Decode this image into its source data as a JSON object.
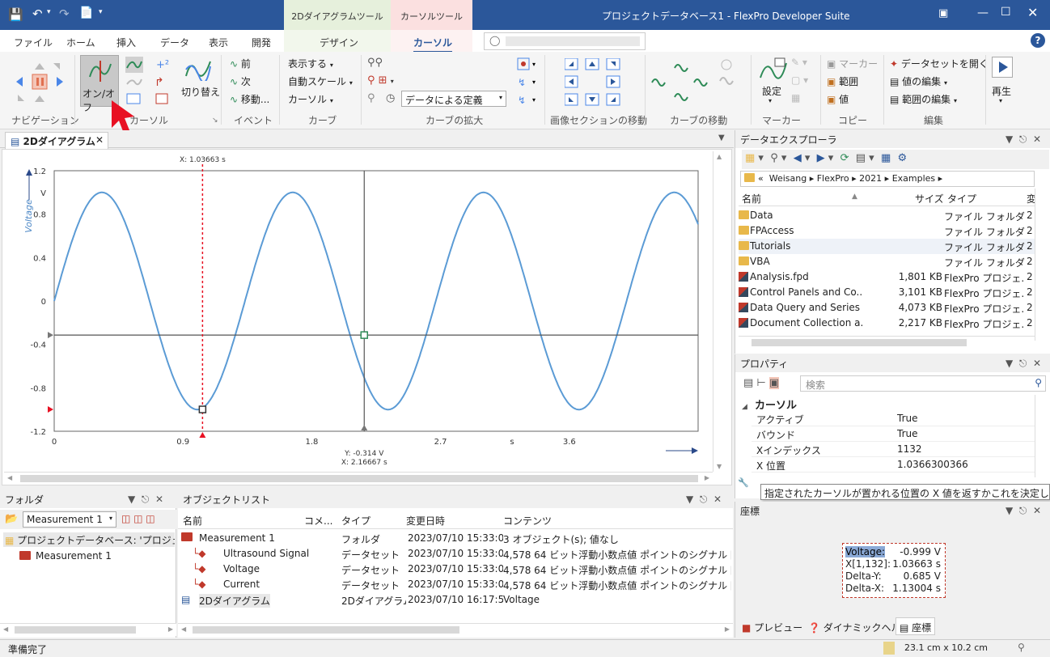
{
  "titlebar": {
    "title": "プロジェクトデータベース1 - FlexPro Developer Suite",
    "context_tab_1": "2Dダイアグラムツール",
    "context_tab_2": "カーソルツール"
  },
  "tabs": [
    "ファイル",
    "ホーム",
    "挿入",
    "データ",
    "表示",
    "開発",
    "デザイン",
    "カーソル"
  ],
  "active_tab": "カーソル",
  "ribbon": {
    "groups": [
      "ナビゲーション",
      "カーソル",
      "イベント",
      "カーブ",
      "カーブの拡大",
      "画像セクションの移動",
      "カーブの移動",
      "マーカー",
      "コピー",
      "編集"
    ],
    "onoff_label": "オン/オフ",
    "switch_label": "切り替え",
    "event_prev": "前",
    "event_next": "次",
    "event_move": "移動...",
    "curve_show": "表示する",
    "curve_autoscale": "自動スケール",
    "curve_cursor": "カーソル",
    "zoom_mode": "データによる定義",
    "settings_label": "設定",
    "marker_label": "マーカー",
    "copy_range": "範囲",
    "copy_value": "値",
    "edit_open_dataset": "データセットを開く",
    "edit_value": "値の編集",
    "edit_range": "範囲の編集",
    "play_label": "再生"
  },
  "doc_tab": {
    "label": "2Dダイアグラム"
  },
  "chart_data": {
    "type": "line",
    "title": "",
    "xlabel": "s",
    "ylabel": "Voltage",
    "yunit": "V",
    "x_ticks": [
      "0",
      "0.9",
      "1.8",
      "2.7",
      "s",
      "3.6"
    ],
    "y_ticks": [
      "1.2",
      "V",
      "0.8",
      "0.4",
      "0",
      "-0.4",
      "-0.8",
      "-1.2"
    ],
    "xlim": [
      0,
      4.5
    ],
    "ylim": [
      -1.2,
      1.2
    ],
    "series": [
      {
        "name": "Voltage",
        "frequency_hz": 0.75,
        "amplitude": 1.0,
        "color": "#5b9bd5"
      }
    ],
    "cursor1": {
      "label": "X: 1.03663 s",
      "x": 1.03663,
      "y": -0.999,
      "color": "#e81123"
    },
    "cursor2": {
      "label_y": "Y: -0.314 V",
      "label_x": "X: 2.16667 s",
      "x": 2.16667,
      "y": -0.314
    },
    "grid": false
  },
  "explorer": {
    "title": "データエクスプローラ",
    "breadcrumb": [
      "Weisang",
      "FlexPro",
      "2021",
      "Examples"
    ],
    "columns": [
      "名前",
      "サイズ",
      "タイプ",
      "変"
    ],
    "rows": [
      {
        "name": "Data",
        "size": "",
        "type": "ファイル フォルダー",
        "mod": "2",
        "kind": "folder"
      },
      {
        "name": "FPAccess",
        "size": "",
        "type": "ファイル フォルダー",
        "mod": "2",
        "kind": "folder"
      },
      {
        "name": "Tutorials",
        "size": "",
        "type": "ファイル フォルダー",
        "mod": "2",
        "kind": "folder"
      },
      {
        "name": "VBA",
        "size": "",
        "type": "ファイル フォルダー",
        "mod": "2",
        "kind": "folder"
      },
      {
        "name": "Analysis.fpd",
        "size": "1,801 KB",
        "type": "FlexPro プロジェ...",
        "mod": "2",
        "kind": "file"
      },
      {
        "name": "Control Panels and Co...",
        "size": "3,101 KB",
        "type": "FlexPro プロジェ...",
        "mod": "2",
        "kind": "file"
      },
      {
        "name": "Data Query and Series ...",
        "size": "4,073 KB",
        "type": "FlexPro プロジェ...",
        "mod": "2",
        "kind": "file"
      },
      {
        "name": "Document Collection a...",
        "size": "2,217 KB",
        "type": "FlexPro プロジェ...",
        "mod": "2",
        "kind": "file"
      }
    ]
  },
  "properties": {
    "title": "プロパティ",
    "search_placeholder": "検索",
    "category": "カーソル",
    "rows": [
      {
        "key": "アクティブ",
        "val": "True"
      },
      {
        "key": "バウンド",
        "val": "True"
      },
      {
        "key": "Xインデックス",
        "val": "1132"
      },
      {
        "key": "X 位置",
        "val": "1.0366300366"
      }
    ],
    "tooltip": "指定されたカーソルが置かれる位置の X 値を返すかこれを決定します。"
  },
  "coords": {
    "title": "座標",
    "rows": [
      {
        "label": "Voltage:",
        "value": "-0.999 V"
      },
      {
        "label": "X[1,132]:",
        "value": "1.03663 s"
      },
      {
        "label": "Delta-Y:",
        "value": "0.685 V"
      },
      {
        "label": "Delta-X:",
        "value": "1.13004 s"
      }
    ],
    "bottom_tabs": [
      "プレビュー",
      "ダイナミックヘルプ",
      "座標"
    ]
  },
  "folder_panel": {
    "title": "フォルダ",
    "dropdown": "Measurement 1",
    "tree": [
      "プロジェクトデータベース: 'プロジェクトデータ",
      "Measurement 1"
    ]
  },
  "objlist": {
    "title": "オブジェクトリスト",
    "columns": [
      "名前",
      "コメ...",
      "タイプ",
      "変更日時",
      "コンテンツ"
    ],
    "rows": [
      {
        "name": "Measurement 1",
        "type": "フォルダ",
        "date": "2023/07/10 15:33:05",
        "content": "3 オブジェクト(s); 値なし",
        "indent": 0,
        "kind": "folder"
      },
      {
        "name": "Ultrasound Signal",
        "type": "データセット",
        "date": "2023/07/10 15:33:05",
        "content": "4,578 64 ビット浮動小数点値 ポイントのシグナル [V, s]",
        "indent": 1,
        "kind": "dataset"
      },
      {
        "name": "Voltage",
        "type": "データセット",
        "date": "2023/07/10 15:33:05",
        "content": "4,578 64 ビット浮動小数点値 ポイントのシグナル [V, s]",
        "indent": 1,
        "kind": "dataset"
      },
      {
        "name": "Current",
        "type": "データセット",
        "date": "2023/07/10 15:33:05",
        "content": "4,578 64 ビット浮動小数点値 ポイントのシグナル [mA, s]",
        "indent": 1,
        "kind": "dataset"
      },
      {
        "name": "2Dダイアグラム",
        "type": "2Dダイアグラム",
        "date": "2023/07/10 16:17:57",
        "content": "Voltage",
        "indent": 0,
        "kind": "diagram"
      }
    ]
  },
  "statusbar": {
    "left": "準備完了",
    "right": "23.1 cm x 10.2 cm"
  }
}
